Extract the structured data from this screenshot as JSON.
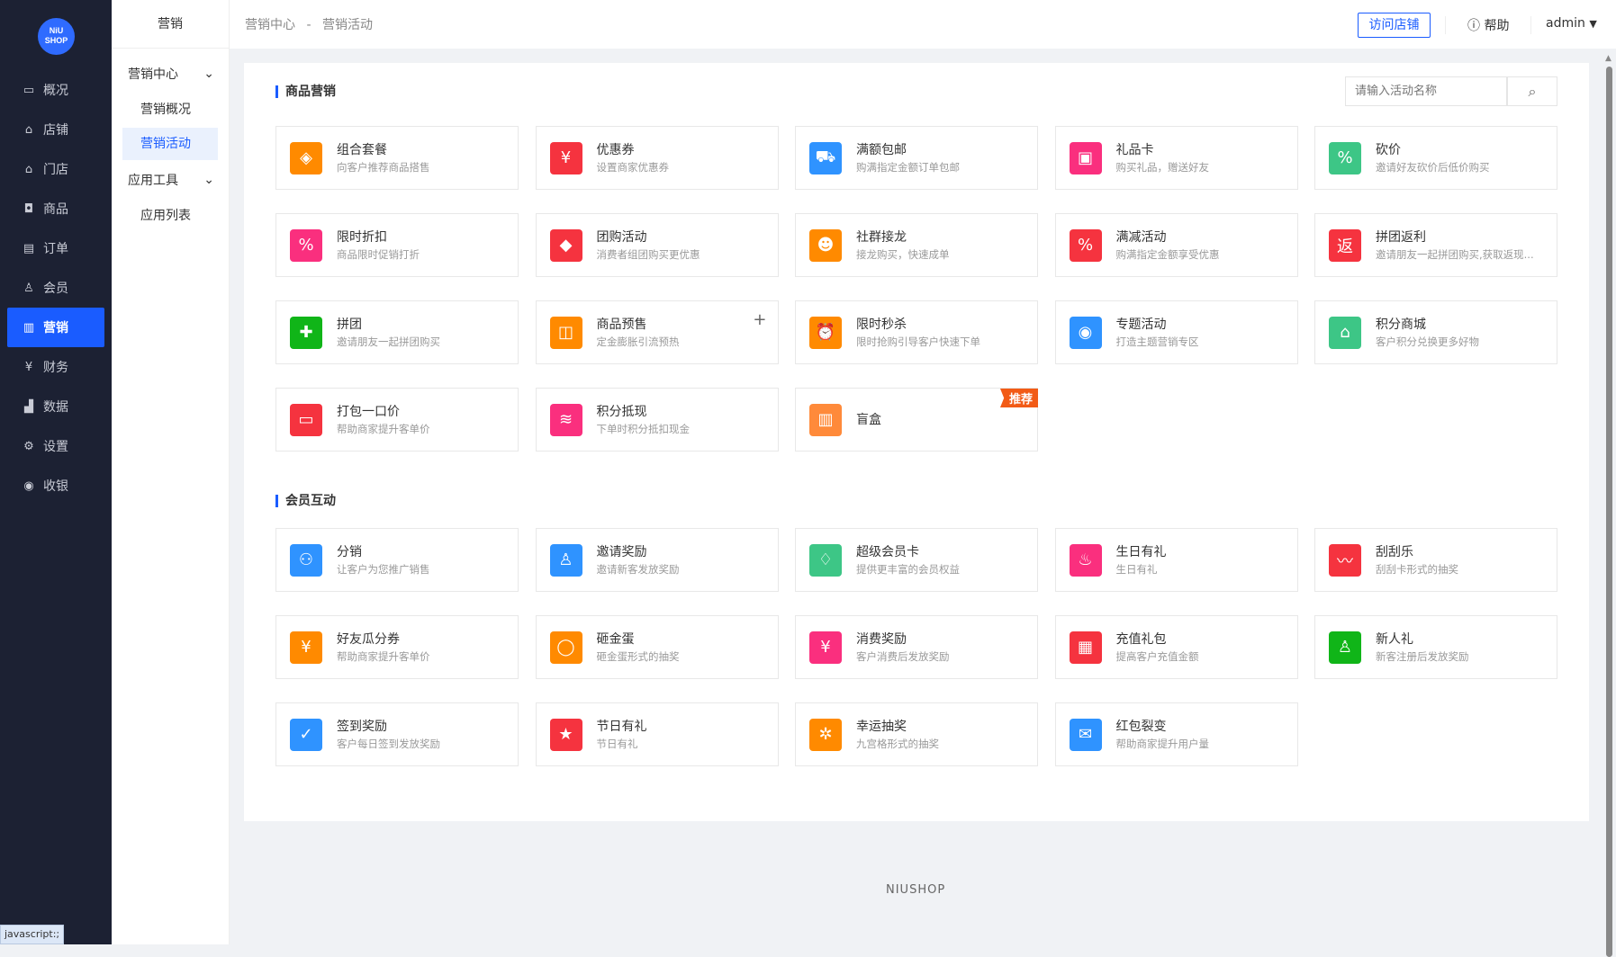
{
  "logo": {
    "line1": "NiU",
    "line2": "SHOP"
  },
  "sidebar": {
    "items": [
      {
        "label": "概况",
        "icon": "chart-icon",
        "glyph": "▭"
      },
      {
        "label": "店铺",
        "icon": "store-icon",
        "glyph": "⌂"
      },
      {
        "label": "门店",
        "icon": "shop-icon",
        "glyph": "⌂"
      },
      {
        "label": "商品",
        "icon": "bag-icon",
        "glyph": "◘"
      },
      {
        "label": "订单",
        "icon": "order-icon",
        "glyph": "▤"
      },
      {
        "label": "会员",
        "icon": "user-icon",
        "glyph": "♙"
      },
      {
        "label": "营销",
        "icon": "bar-chart-icon",
        "glyph": "▥",
        "active": true
      },
      {
        "label": "财务",
        "icon": "yuan-icon",
        "glyph": "¥"
      },
      {
        "label": "数据",
        "icon": "data-icon",
        "glyph": "▟"
      },
      {
        "label": "设置",
        "icon": "gear-icon",
        "glyph": "⚙"
      },
      {
        "label": "收银",
        "icon": "cashier-icon",
        "glyph": "◉"
      }
    ]
  },
  "subnav": {
    "title": "营销",
    "groups": [
      {
        "label": "营销中心",
        "items": [
          "营销概况",
          "营销活动"
        ]
      },
      {
        "label": "应用工具",
        "items": [
          "应用列表"
        ]
      }
    ],
    "active": "营销活动"
  },
  "header": {
    "breadcrumb": [
      "营销中心",
      "营销活动"
    ],
    "breadcrumb_sep": "-",
    "visit_store": "访问店铺",
    "help": "帮助",
    "user": "admin"
  },
  "search": {
    "placeholder": "请输入活动名称"
  },
  "sections": [
    {
      "title": "商品营销",
      "cards": [
        {
          "title": "组合套餐",
          "desc": "向客户推荐商品搭售",
          "color": "#ff8a00",
          "glyph": "◈",
          "icon": "layers-icon"
        },
        {
          "title": "优惠券",
          "desc": "设置商家优惠券",
          "color": "#f5333f",
          "glyph": "¥",
          "icon": "coupon-icon"
        },
        {
          "title": "满额包邮",
          "desc": "购满指定金额订单包邮",
          "color": "#2f93ff",
          "glyph": "⛟",
          "icon": "truck-icon"
        },
        {
          "title": "礼品卡",
          "desc": "购买礼品，赠送好友",
          "color": "#fa2f7e",
          "glyph": "▣",
          "icon": "gift-card-icon"
        },
        {
          "title": "砍价",
          "desc": "邀请好友砍价后低价购买",
          "color": "#3dc686",
          "glyph": "%",
          "icon": "tag-icon"
        },
        {
          "title": "限时折扣",
          "desc": "商品限时促销打折",
          "color": "#fa2f7e",
          "glyph": "%",
          "icon": "discount-icon"
        },
        {
          "title": "团购活动",
          "desc": "消费者组团购买更优惠",
          "color": "#f5333f",
          "glyph": "◆",
          "icon": "price-tag-icon"
        },
        {
          "title": "社群接龙",
          "desc": "接龙购买，快速成单",
          "color": "#ff8a00",
          "glyph": "☻",
          "icon": "group-icon"
        },
        {
          "title": "满减活动",
          "desc": "购满指定金额享受优惠",
          "color": "#f5333f",
          "glyph": "%",
          "icon": "ticket-icon"
        },
        {
          "title": "拼团返利",
          "desc": "邀请朋友一起拼团购买,获取返现...",
          "color": "#f5333f",
          "glyph": "返",
          "icon": "rebate-icon"
        },
        {
          "title": "拼团",
          "desc": "邀请朋友一起拼团购买",
          "color": "#10b518",
          "glyph": "✚",
          "icon": "puzzle-icon"
        },
        {
          "title": "商品预售",
          "desc": "定金膨胀引流预热",
          "color": "#ff8a00",
          "glyph": "◫",
          "icon": "presale-icon",
          "plus": "+"
        },
        {
          "title": "限时秒杀",
          "desc": "限时抢购引导客户快速下单",
          "color": "#ff8a00",
          "glyph": "⏰",
          "icon": "alarm-icon"
        },
        {
          "title": "专题活动",
          "desc": "打造主题营销专区",
          "color": "#2f93ff",
          "glyph": "◉",
          "icon": "bulb-icon"
        },
        {
          "title": "积分商城",
          "desc": "客户积分兑换更多好物",
          "color": "#3dc686",
          "glyph": "⌂",
          "icon": "mall-icon"
        },
        {
          "title": "打包一口价",
          "desc": "帮助商家提升客单价",
          "color": "#f5333f",
          "glyph": "▭",
          "icon": "box-icon"
        },
        {
          "title": "积分抵现",
          "desc": "下单时积分抵扣现金",
          "color": "#fa2f7e",
          "glyph": "≋",
          "icon": "coins-icon"
        },
        {
          "title": "盲盒",
          "desc": "",
          "color": "#ff8a3a",
          "glyph": "▥",
          "icon": "blind-box-icon",
          "badge": "推荐"
        }
      ]
    },
    {
      "title": "会员互动",
      "cards": [
        {
          "title": "分销",
          "desc": "让客户为您推广销售",
          "color": "#2f93ff",
          "glyph": "⚇",
          "icon": "distribution-icon"
        },
        {
          "title": "邀请奖励",
          "desc": "邀请新客发放奖励",
          "color": "#2f93ff",
          "glyph": "♙",
          "icon": "invite-icon"
        },
        {
          "title": "超级会员卡",
          "desc": "提供更丰富的会员权益",
          "color": "#3dc686",
          "glyph": "♢",
          "icon": "diamond-icon"
        },
        {
          "title": "生日有礼",
          "desc": "生日有礼",
          "color": "#fa2f7e",
          "glyph": "♨",
          "icon": "cake-icon"
        },
        {
          "title": "刮刮乐",
          "desc": "刮刮卡形式的抽奖",
          "color": "#f5333f",
          "glyph": "〰",
          "icon": "scratch-icon"
        },
        {
          "title": "好友瓜分券",
          "desc": "帮助商家提升客单价",
          "color": "#ff8a00",
          "glyph": "¥",
          "icon": "share-coupon-icon"
        },
        {
          "title": "砸金蛋",
          "desc": "砸金蛋形式的抽奖",
          "color": "#ff8a00",
          "glyph": "◯",
          "icon": "egg-icon"
        },
        {
          "title": "消费奖励",
          "desc": "客户消费后发放奖励",
          "color": "#fa2f7e",
          "glyph": "¥",
          "icon": "money-bag-icon"
        },
        {
          "title": "充值礼包",
          "desc": "提高客户充值金额",
          "color": "#f5333f",
          "glyph": "▦",
          "icon": "gift-icon"
        },
        {
          "title": "新人礼",
          "desc": "新客注册后发放奖励",
          "color": "#10b518",
          "glyph": "♙",
          "icon": "new-user-icon"
        },
        {
          "title": "签到奖励",
          "desc": "客户每日签到发放奖励",
          "color": "#2f93ff",
          "glyph": "✓",
          "icon": "calendar-check-icon"
        },
        {
          "title": "节日有礼",
          "desc": "节日有礼",
          "color": "#f5333f",
          "glyph": "★",
          "icon": "star-icon"
        },
        {
          "title": "幸运抽奖",
          "desc": "九宫格形式的抽奖",
          "color": "#ff8a00",
          "glyph": "✲",
          "icon": "wheel-icon"
        },
        {
          "title": "红包裂变",
          "desc": "帮助商家提升用户量",
          "color": "#2f93ff",
          "glyph": "✉",
          "icon": "red-packet-icon"
        }
      ]
    }
  ],
  "footer": "NIUSHOP",
  "status_bar": "javascript:;"
}
